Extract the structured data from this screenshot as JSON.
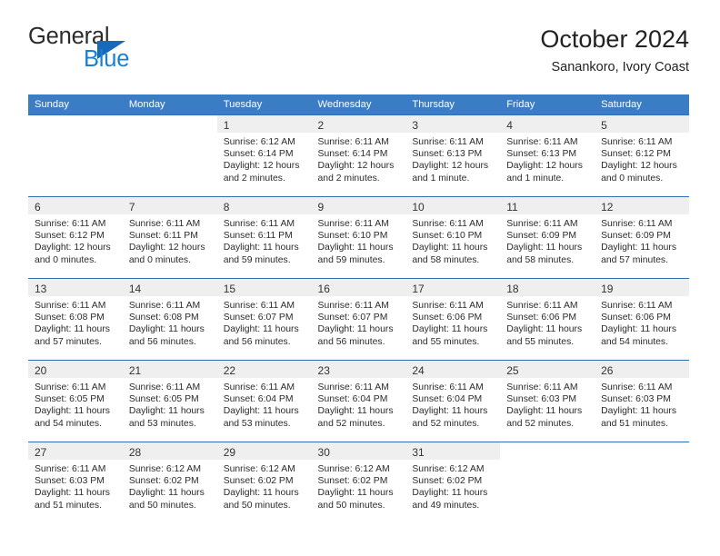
{
  "brand": {
    "name_top": "General",
    "name_bottom": "Blue",
    "triangle_color": "#1769ba",
    "blue_text_color": "#1880d4"
  },
  "header": {
    "title": "October 2024",
    "subtitle": "Sanankoro, Ivory Coast"
  },
  "theme": {
    "header_blue": "#3b7dc4",
    "row_border_blue": "#2f6fb5",
    "band_gray": "#efefef"
  },
  "labels": {
    "sunrise_prefix": "Sunrise:",
    "sunset_prefix": "Sunset:",
    "daylight_prefix": "Daylight:"
  },
  "weekdays": [
    "Sunday",
    "Monday",
    "Tuesday",
    "Wednesday",
    "Thursday",
    "Friday",
    "Saturday"
  ],
  "weeks": [
    [
      {
        "day": "",
        "sunrise": "",
        "sunset": "",
        "daylight_line1": "",
        "daylight_line2": ""
      },
      {
        "day": "",
        "sunrise": "",
        "sunset": "",
        "daylight_line1": "",
        "daylight_line2": ""
      },
      {
        "day": "1",
        "sunrise": "Sunrise: 6:12 AM",
        "sunset": "Sunset: 6:14 PM",
        "daylight_line1": "Daylight: 12 hours",
        "daylight_line2": "and 2 minutes."
      },
      {
        "day": "2",
        "sunrise": "Sunrise: 6:11 AM",
        "sunset": "Sunset: 6:14 PM",
        "daylight_line1": "Daylight: 12 hours",
        "daylight_line2": "and 2 minutes."
      },
      {
        "day": "3",
        "sunrise": "Sunrise: 6:11 AM",
        "sunset": "Sunset: 6:13 PM",
        "daylight_line1": "Daylight: 12 hours",
        "daylight_line2": "and 1 minute."
      },
      {
        "day": "4",
        "sunrise": "Sunrise: 6:11 AM",
        "sunset": "Sunset: 6:13 PM",
        "daylight_line1": "Daylight: 12 hours",
        "daylight_line2": "and 1 minute."
      },
      {
        "day": "5",
        "sunrise": "Sunrise: 6:11 AM",
        "sunset": "Sunset: 6:12 PM",
        "daylight_line1": "Daylight: 12 hours",
        "daylight_line2": "and 0 minutes."
      }
    ],
    [
      {
        "day": "6",
        "sunrise": "Sunrise: 6:11 AM",
        "sunset": "Sunset: 6:12 PM",
        "daylight_line1": "Daylight: 12 hours",
        "daylight_line2": "and 0 minutes."
      },
      {
        "day": "7",
        "sunrise": "Sunrise: 6:11 AM",
        "sunset": "Sunset: 6:11 PM",
        "daylight_line1": "Daylight: 12 hours",
        "daylight_line2": "and 0 minutes."
      },
      {
        "day": "8",
        "sunrise": "Sunrise: 6:11 AM",
        "sunset": "Sunset: 6:11 PM",
        "daylight_line1": "Daylight: 11 hours",
        "daylight_line2": "and 59 minutes."
      },
      {
        "day": "9",
        "sunrise": "Sunrise: 6:11 AM",
        "sunset": "Sunset: 6:10 PM",
        "daylight_line1": "Daylight: 11 hours",
        "daylight_line2": "and 59 minutes."
      },
      {
        "day": "10",
        "sunrise": "Sunrise: 6:11 AM",
        "sunset": "Sunset: 6:10 PM",
        "daylight_line1": "Daylight: 11 hours",
        "daylight_line2": "and 58 minutes."
      },
      {
        "day": "11",
        "sunrise": "Sunrise: 6:11 AM",
        "sunset": "Sunset: 6:09 PM",
        "daylight_line1": "Daylight: 11 hours",
        "daylight_line2": "and 58 minutes."
      },
      {
        "day": "12",
        "sunrise": "Sunrise: 6:11 AM",
        "sunset": "Sunset: 6:09 PM",
        "daylight_line1": "Daylight: 11 hours",
        "daylight_line2": "and 57 minutes."
      }
    ],
    [
      {
        "day": "13",
        "sunrise": "Sunrise: 6:11 AM",
        "sunset": "Sunset: 6:08 PM",
        "daylight_line1": "Daylight: 11 hours",
        "daylight_line2": "and 57 minutes."
      },
      {
        "day": "14",
        "sunrise": "Sunrise: 6:11 AM",
        "sunset": "Sunset: 6:08 PM",
        "daylight_line1": "Daylight: 11 hours",
        "daylight_line2": "and 56 minutes."
      },
      {
        "day": "15",
        "sunrise": "Sunrise: 6:11 AM",
        "sunset": "Sunset: 6:07 PM",
        "daylight_line1": "Daylight: 11 hours",
        "daylight_line2": "and 56 minutes."
      },
      {
        "day": "16",
        "sunrise": "Sunrise: 6:11 AM",
        "sunset": "Sunset: 6:07 PM",
        "daylight_line1": "Daylight: 11 hours",
        "daylight_line2": "and 56 minutes."
      },
      {
        "day": "17",
        "sunrise": "Sunrise: 6:11 AM",
        "sunset": "Sunset: 6:06 PM",
        "daylight_line1": "Daylight: 11 hours",
        "daylight_line2": "and 55 minutes."
      },
      {
        "day": "18",
        "sunrise": "Sunrise: 6:11 AM",
        "sunset": "Sunset: 6:06 PM",
        "daylight_line1": "Daylight: 11 hours",
        "daylight_line2": "and 55 minutes."
      },
      {
        "day": "19",
        "sunrise": "Sunrise: 6:11 AM",
        "sunset": "Sunset: 6:06 PM",
        "daylight_line1": "Daylight: 11 hours",
        "daylight_line2": "and 54 minutes."
      }
    ],
    [
      {
        "day": "20",
        "sunrise": "Sunrise: 6:11 AM",
        "sunset": "Sunset: 6:05 PM",
        "daylight_line1": "Daylight: 11 hours",
        "daylight_line2": "and 54 minutes."
      },
      {
        "day": "21",
        "sunrise": "Sunrise: 6:11 AM",
        "sunset": "Sunset: 6:05 PM",
        "daylight_line1": "Daylight: 11 hours",
        "daylight_line2": "and 53 minutes."
      },
      {
        "day": "22",
        "sunrise": "Sunrise: 6:11 AM",
        "sunset": "Sunset: 6:04 PM",
        "daylight_line1": "Daylight: 11 hours",
        "daylight_line2": "and 53 minutes."
      },
      {
        "day": "23",
        "sunrise": "Sunrise: 6:11 AM",
        "sunset": "Sunset: 6:04 PM",
        "daylight_line1": "Daylight: 11 hours",
        "daylight_line2": "and 52 minutes."
      },
      {
        "day": "24",
        "sunrise": "Sunrise: 6:11 AM",
        "sunset": "Sunset: 6:04 PM",
        "daylight_line1": "Daylight: 11 hours",
        "daylight_line2": "and 52 minutes."
      },
      {
        "day": "25",
        "sunrise": "Sunrise: 6:11 AM",
        "sunset": "Sunset: 6:03 PM",
        "daylight_line1": "Daylight: 11 hours",
        "daylight_line2": "and 52 minutes."
      },
      {
        "day": "26",
        "sunrise": "Sunrise: 6:11 AM",
        "sunset": "Sunset: 6:03 PM",
        "daylight_line1": "Daylight: 11 hours",
        "daylight_line2": "and 51 minutes."
      }
    ],
    [
      {
        "day": "27",
        "sunrise": "Sunrise: 6:11 AM",
        "sunset": "Sunset: 6:03 PM",
        "daylight_line1": "Daylight: 11 hours",
        "daylight_line2": "and 51 minutes."
      },
      {
        "day": "28",
        "sunrise": "Sunrise: 6:12 AM",
        "sunset": "Sunset: 6:02 PM",
        "daylight_line1": "Daylight: 11 hours",
        "daylight_line2": "and 50 minutes."
      },
      {
        "day": "29",
        "sunrise": "Sunrise: 6:12 AM",
        "sunset": "Sunset: 6:02 PM",
        "daylight_line1": "Daylight: 11 hours",
        "daylight_line2": "and 50 minutes."
      },
      {
        "day": "30",
        "sunrise": "Sunrise: 6:12 AM",
        "sunset": "Sunset: 6:02 PM",
        "daylight_line1": "Daylight: 11 hours",
        "daylight_line2": "and 50 minutes."
      },
      {
        "day": "31",
        "sunrise": "Sunrise: 6:12 AM",
        "sunset": "Sunset: 6:02 PM",
        "daylight_line1": "Daylight: 11 hours",
        "daylight_line2": "and 49 minutes."
      },
      {
        "day": "",
        "sunrise": "",
        "sunset": "",
        "daylight_line1": "",
        "daylight_line2": ""
      },
      {
        "day": "",
        "sunrise": "",
        "sunset": "",
        "daylight_line1": "",
        "daylight_line2": ""
      }
    ]
  ]
}
